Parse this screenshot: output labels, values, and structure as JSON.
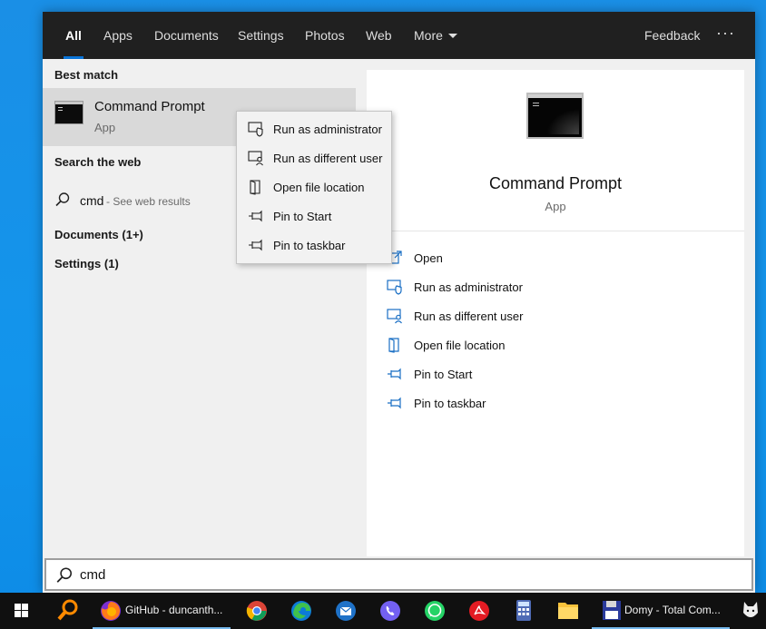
{
  "tabs": [
    {
      "label": "All",
      "active": true
    },
    {
      "label": "Apps"
    },
    {
      "label": "Documents"
    },
    {
      "label": "Settings"
    },
    {
      "label": "Photos"
    },
    {
      "label": "Web"
    },
    {
      "label": "More"
    }
  ],
  "header": {
    "feedback": "Feedback",
    "more_options": "···"
  },
  "results": {
    "best_match_heading": "Best match",
    "best_match": {
      "title": "Command Prompt",
      "subtitle": "App",
      "icon": "command-prompt-icon"
    },
    "search_web_heading": "Search the web",
    "web_query": "cmd",
    "web_hint": "- See web results",
    "documents": "Documents (1+)",
    "settings": "Settings (1)"
  },
  "details": {
    "title": "Command Prompt",
    "subtitle": "App",
    "actions": [
      {
        "label": "Open",
        "icon": "open-icon"
      },
      {
        "label": "Run as administrator",
        "icon": "shield-icon"
      },
      {
        "label": "Run as different user",
        "icon": "user-icon"
      },
      {
        "label": "Open file location",
        "icon": "file-location-icon"
      },
      {
        "label": "Pin to Start",
        "icon": "pin-icon"
      },
      {
        "label": "Pin to taskbar",
        "icon": "pin-icon"
      }
    ]
  },
  "context_menu": [
    {
      "label": "Run as administrator",
      "icon": "shield-icon"
    },
    {
      "label": "Run as different user",
      "icon": "user-icon"
    },
    {
      "label": "Open file location",
      "icon": "file-location-icon"
    },
    {
      "label": "Pin to Start",
      "icon": "pin-icon"
    },
    {
      "label": "Pin to taskbar",
      "icon": "pin-icon"
    }
  ],
  "search": {
    "value": "cmd"
  },
  "taskbar": {
    "firefox_label": "GitHub - duncanth...",
    "commander_label": "Domy - Total Com..."
  },
  "colors": {
    "accent": "#0a74d8",
    "tabbar": "#202020",
    "desktop": "#1a8fe6"
  }
}
